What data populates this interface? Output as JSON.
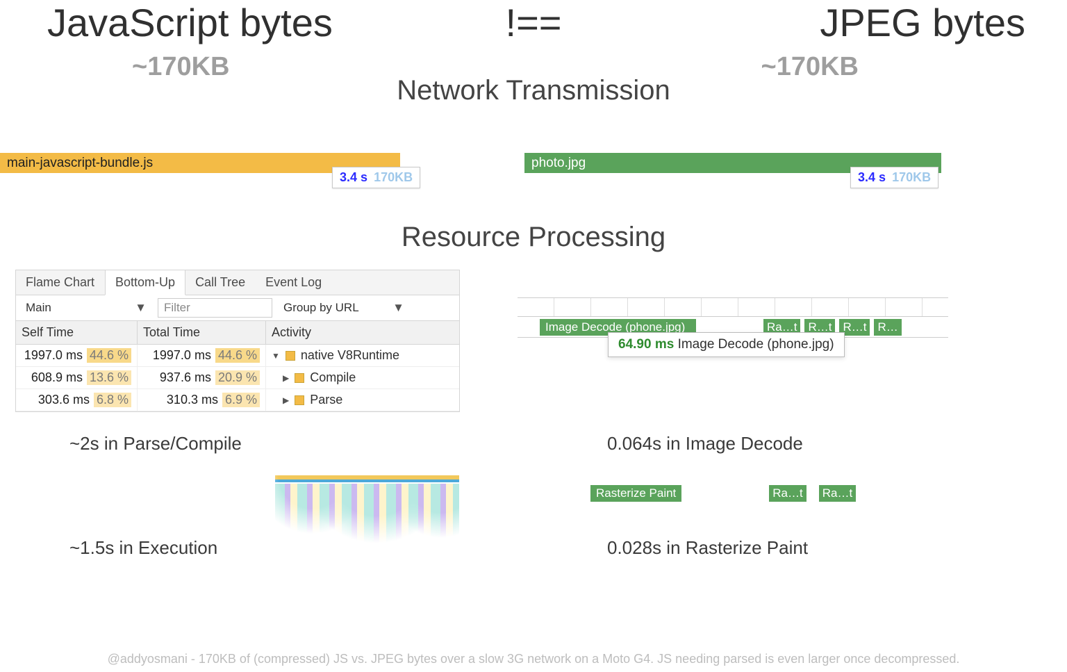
{
  "headline": {
    "left": "JavaScript bytes",
    "op": "!==",
    "right": "JPEG bytes"
  },
  "size_label": {
    "left": "~170KB",
    "right": "~170KB"
  },
  "section": {
    "net": "Network Transmission",
    "res": "Resource Processing"
  },
  "net": {
    "js": {
      "file": "main-javascript-bundle.js",
      "time": "3.4 s",
      "size": "170KB"
    },
    "jpeg": {
      "file": "photo.jpg",
      "time": "3.4 s",
      "size": "170KB"
    }
  },
  "devtools": {
    "tabs": [
      "Flame Chart",
      "Bottom-Up",
      "Call Tree",
      "Event Log"
    ],
    "active_tab": 1,
    "thread": "Main",
    "filter_placeholder": "Filter",
    "group": "Group by URL",
    "columns": [
      "Self Time",
      "Total Time",
      "Activity"
    ],
    "rows": [
      {
        "self_ms": "1997.0 ms",
        "self_pct": "44.6 %",
        "total_ms": "1997.0 ms",
        "total_pct": "44.6 %",
        "activity": "native V8Runtime",
        "depth": 0
      },
      {
        "self_ms": "608.9 ms",
        "self_pct": "13.6 %",
        "total_ms": "937.6 ms",
        "total_pct": "20.9 %",
        "activity": "Compile",
        "depth": 1
      },
      {
        "self_ms": "303.6 ms",
        "self_pct": "6.8 %",
        "total_ms": "310.3 ms",
        "total_pct": "6.9 %",
        "activity": "Parse",
        "depth": 1
      }
    ]
  },
  "timeline": {
    "main_block": "Image Decode (phone.jpg)",
    "tails": [
      "Ra…t",
      "R…t",
      "R…t",
      "R…"
    ],
    "tooltip_ms": "64.90 ms",
    "tooltip_label": "Image Decode (phone.jpg)"
  },
  "raster": {
    "blocks": [
      "Rasterize Paint",
      "Ra…t",
      "Ra…t"
    ]
  },
  "annot": {
    "parse": "~2s in Parse/Compile",
    "exec": "~1.5s in Execution",
    "decode": "0.064s in Image Decode",
    "raster": "0.028s in Rasterize Paint"
  },
  "footer": "@addyosmani - 170KB of (compressed) JS vs. JPEG bytes over a slow 3G network on a Moto G4. JS needing parsed is even larger once decompressed."
}
